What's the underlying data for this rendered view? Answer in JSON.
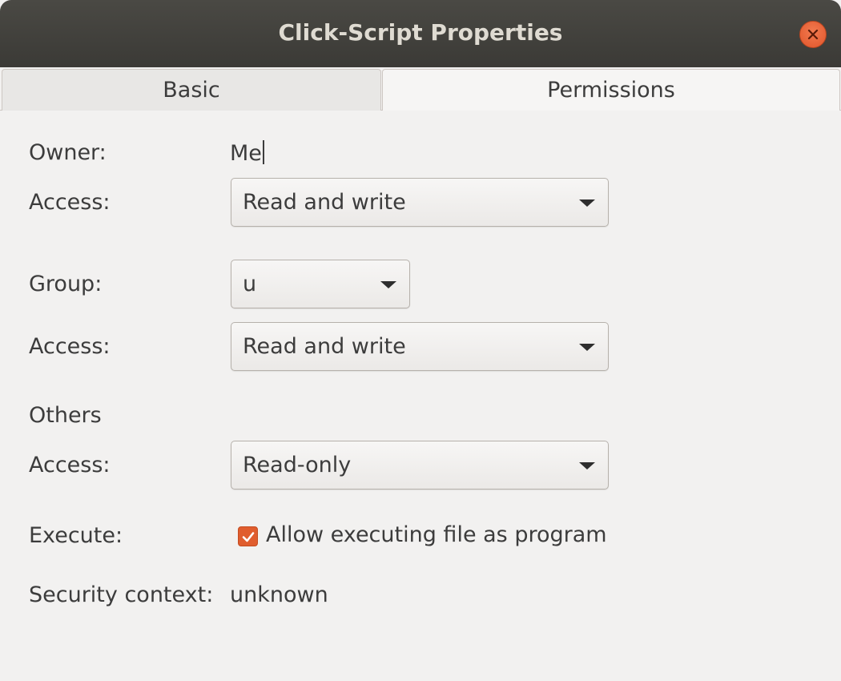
{
  "window": {
    "title": "Click-Script Properties"
  },
  "tabs": [
    {
      "label": "Basic"
    },
    {
      "label": "Permissions"
    }
  ],
  "owner": {
    "label": "Owner:",
    "value": "Me",
    "access_label": "Access:",
    "access_value": "Read and write"
  },
  "group": {
    "label": "Group:",
    "value": "u",
    "access_label": "Access:",
    "access_value": "Read and write"
  },
  "others": {
    "label": "Others",
    "access_label": "Access:",
    "access_value": "Read-only"
  },
  "execute": {
    "label": "Execute:",
    "checkbox_label": "Allow executing file as program",
    "checked": true
  },
  "security": {
    "label": "Security context:",
    "value": "unknown"
  },
  "icons": {
    "close": "close-icon",
    "dropdown": "chevron-down-icon",
    "check": "check-icon"
  },
  "colors": {
    "accent": "#e05d2e",
    "titlebar": "#3b3a36",
    "background": "#f2f1f0"
  }
}
